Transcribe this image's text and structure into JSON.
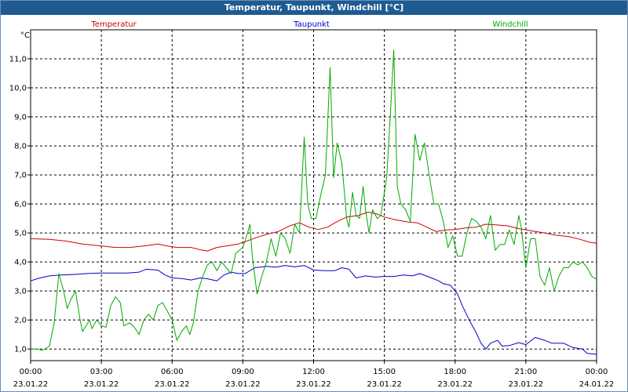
{
  "window": {
    "title": "Temperatur, Taupunkt, Windchill [°C]"
  },
  "chart_data": {
    "type": "line",
    "title": "Temperatur, Taupunkt, Windchill [°C]",
    "ylabel": "°C",
    "ylim": [
      0.6,
      12.0
    ],
    "xlim": [
      0,
      24
    ],
    "y_ticks": [
      "1,0",
      "2,0",
      "3,0",
      "4,0",
      "5,0",
      "6,0",
      "7,0",
      "8,0",
      "9,0",
      "10,0",
      "11,0"
    ],
    "y_tick_values": [
      1,
      2,
      3,
      4,
      5,
      6,
      7,
      8,
      9,
      10,
      11
    ],
    "x_ticks": [
      {
        "time": "00:00",
        "date": "23.01.22"
      },
      {
        "time": "03:00",
        "date": "23.01.22"
      },
      {
        "time": "06:00",
        "date": "23.01.22"
      },
      {
        "time": "09:00",
        "date": "23.01.22"
      },
      {
        "time": "12:00",
        "date": "23.01.22"
      },
      {
        "time": "15:00",
        "date": "23.01.22"
      },
      {
        "time": "18:00",
        "date": "23.01.22"
      },
      {
        "time": "21:00",
        "date": "23.01.22"
      },
      {
        "time": "00:00",
        "date": "24.01.22"
      }
    ],
    "grid": true,
    "legend_position": "top",
    "x_unit": "hours",
    "series": [
      {
        "name": "Temperatur",
        "color": "#cc0000",
        "points": [
          [
            0,
            4.8
          ],
          [
            0.8,
            4.78
          ],
          [
            1.5,
            4.72
          ],
          [
            2.2,
            4.62
          ],
          [
            3.0,
            4.55
          ],
          [
            3.6,
            4.5
          ],
          [
            4.2,
            4.5
          ],
          [
            4.8,
            4.55
          ],
          [
            5.4,
            4.62
          ],
          [
            5.8,
            4.55
          ],
          [
            6.2,
            4.5
          ],
          [
            6.8,
            4.5
          ],
          [
            7.2,
            4.42
          ],
          [
            7.5,
            4.38
          ],
          [
            7.9,
            4.5
          ],
          [
            8.3,
            4.55
          ],
          [
            8.8,
            4.62
          ],
          [
            9.1,
            4.7
          ],
          [
            9.6,
            4.85
          ],
          [
            10.0,
            4.95
          ],
          [
            10.5,
            5.05
          ],
          [
            11.0,
            5.25
          ],
          [
            11.4,
            5.35
          ],
          [
            11.8,
            5.2
          ],
          [
            12.2,
            5.12
          ],
          [
            12.6,
            5.2
          ],
          [
            12.9,
            5.35
          ],
          [
            13.4,
            5.55
          ],
          [
            13.9,
            5.6
          ],
          [
            14.3,
            5.72
          ],
          [
            14.7,
            5.65
          ],
          [
            15.0,
            5.55
          ],
          [
            15.5,
            5.45
          ],
          [
            16.0,
            5.38
          ],
          [
            16.4,
            5.35
          ],
          [
            16.8,
            5.2
          ],
          [
            17.2,
            5.05
          ],
          [
            17.6,
            5.1
          ],
          [
            18.0,
            5.12
          ],
          [
            18.5,
            5.18
          ],
          [
            18.9,
            5.2
          ],
          [
            19.3,
            5.3
          ],
          [
            19.7,
            5.28
          ],
          [
            20.2,
            5.25
          ],
          [
            20.7,
            5.15
          ],
          [
            21.2,
            5.08
          ],
          [
            21.8,
            5.0
          ],
          [
            22.3,
            4.92
          ],
          [
            22.8,
            4.88
          ],
          [
            23.3,
            4.78
          ],
          [
            23.7,
            4.68
          ],
          [
            24.0,
            4.65
          ]
        ]
      },
      {
        "name": "Taupunkt",
        "color": "#0000cc",
        "points": [
          [
            0,
            3.35
          ],
          [
            0.4,
            3.45
          ],
          [
            0.8,
            3.52
          ],
          [
            1.3,
            3.55
          ],
          [
            1.8,
            3.57
          ],
          [
            2.4,
            3.6
          ],
          [
            3.0,
            3.62
          ],
          [
            3.6,
            3.62
          ],
          [
            4.1,
            3.62
          ],
          [
            4.6,
            3.65
          ],
          [
            4.9,
            3.75
          ],
          [
            5.4,
            3.72
          ],
          [
            5.7,
            3.55
          ],
          [
            6.0,
            3.45
          ],
          [
            6.4,
            3.43
          ],
          [
            6.8,
            3.38
          ],
          [
            7.2,
            3.45
          ],
          [
            7.5,
            3.42
          ],
          [
            7.9,
            3.35
          ],
          [
            8.2,
            3.55
          ],
          [
            8.5,
            3.65
          ],
          [
            8.8,
            3.6
          ],
          [
            9.1,
            3.6
          ],
          [
            9.5,
            3.8
          ],
          [
            10.0,
            3.85
          ],
          [
            10.4,
            3.82
          ],
          [
            10.8,
            3.88
          ],
          [
            11.2,
            3.83
          ],
          [
            11.6,
            3.88
          ],
          [
            12.0,
            3.72
          ],
          [
            12.5,
            3.7
          ],
          [
            12.9,
            3.7
          ],
          [
            13.2,
            3.8
          ],
          [
            13.5,
            3.75
          ],
          [
            13.8,
            3.45
          ],
          [
            14.2,
            3.52
          ],
          [
            14.6,
            3.48
          ],
          [
            15.0,
            3.5
          ],
          [
            15.4,
            3.5
          ],
          [
            15.8,
            3.55
          ],
          [
            16.2,
            3.52
          ],
          [
            16.5,
            3.6
          ],
          [
            17.0,
            3.45
          ],
          [
            17.3,
            3.35
          ],
          [
            17.5,
            3.25
          ],
          [
            17.8,
            3.2
          ],
          [
            18.1,
            2.9
          ],
          [
            18.3,
            2.5
          ],
          [
            18.6,
            2.0
          ],
          [
            18.9,
            1.55
          ],
          [
            19.1,
            1.2
          ],
          [
            19.3,
            1.0
          ],
          [
            19.5,
            1.2
          ],
          [
            19.8,
            1.3
          ],
          [
            20.0,
            1.1
          ],
          [
            20.3,
            1.12
          ],
          [
            20.7,
            1.22
          ],
          [
            21.0,
            1.15
          ],
          [
            21.4,
            1.4
          ],
          [
            21.8,
            1.3
          ],
          [
            22.1,
            1.2
          ],
          [
            22.6,
            1.2
          ],
          [
            23.0,
            1.05
          ],
          [
            23.4,
            1.0
          ],
          [
            23.6,
            0.85
          ],
          [
            24.0,
            0.82
          ]
        ]
      },
      {
        "name": "Windchill",
        "color": "#00aa00",
        "points": [
          [
            0,
            1.0
          ],
          [
            0.3,
            1.0
          ],
          [
            0.5,
            0.95
          ],
          [
            0.8,
            1.1
          ],
          [
            1.0,
            1.9
          ],
          [
            1.2,
            3.6
          ],
          [
            1.4,
            3.0
          ],
          [
            1.55,
            2.4
          ],
          [
            1.7,
            2.7
          ],
          [
            1.9,
            3.0
          ],
          [
            2.1,
            2.0
          ],
          [
            2.2,
            1.6
          ],
          [
            2.5,
            2.0
          ],
          [
            2.6,
            1.7
          ],
          [
            2.8,
            2.0
          ],
          [
            3.0,
            1.8
          ],
          [
            3.2,
            1.75
          ],
          [
            3.4,
            2.5
          ],
          [
            3.6,
            2.8
          ],
          [
            3.8,
            2.6
          ],
          [
            3.95,
            1.8
          ],
          [
            4.2,
            1.9
          ],
          [
            4.4,
            1.75
          ],
          [
            4.6,
            1.5
          ],
          [
            4.8,
            2.0
          ],
          [
            5.0,
            2.2
          ],
          [
            5.2,
            2.0
          ],
          [
            5.4,
            2.5
          ],
          [
            5.6,
            2.6
          ],
          [
            5.8,
            2.3
          ],
          [
            6.0,
            2.0
          ],
          [
            6.2,
            1.3
          ],
          [
            6.4,
            1.6
          ],
          [
            6.6,
            1.8
          ],
          [
            6.75,
            1.5
          ],
          [
            6.9,
            1.9
          ],
          [
            7.1,
            3.0
          ],
          [
            7.3,
            3.5
          ],
          [
            7.5,
            3.9
          ],
          [
            7.7,
            4.0
          ],
          [
            7.9,
            3.7
          ],
          [
            8.1,
            4.0
          ],
          [
            8.3,
            3.8
          ],
          [
            8.5,
            3.6
          ],
          [
            8.7,
            4.3
          ],
          [
            9.0,
            4.5
          ],
          [
            9.2,
            5.0
          ],
          [
            9.3,
            5.3
          ],
          [
            9.4,
            4.2
          ],
          [
            9.6,
            2.9
          ],
          [
            9.8,
            3.5
          ],
          [
            10.0,
            4.0
          ],
          [
            10.2,
            4.8
          ],
          [
            10.4,
            4.2
          ],
          [
            10.6,
            5.0
          ],
          [
            10.8,
            4.8
          ],
          [
            11.0,
            4.3
          ],
          [
            11.2,
            5.3
          ],
          [
            11.4,
            5.0
          ],
          [
            11.6,
            8.3
          ],
          [
            11.75,
            6.0
          ],
          [
            11.9,
            5.5
          ],
          [
            12.1,
            5.5
          ],
          [
            12.3,
            6.3
          ],
          [
            12.5,
            7.0
          ],
          [
            12.7,
            10.7
          ],
          [
            12.85,
            6.9
          ],
          [
            13.0,
            8.1
          ],
          [
            13.2,
            7.4
          ],
          [
            13.4,
            5.5
          ],
          [
            13.5,
            5.2
          ],
          [
            13.65,
            6.4
          ],
          [
            13.8,
            5.6
          ],
          [
            13.95,
            5.5
          ],
          [
            14.1,
            6.6
          ],
          [
            14.2,
            5.8
          ],
          [
            14.35,
            5.0
          ],
          [
            14.5,
            5.8
          ],
          [
            14.7,
            5.5
          ],
          [
            14.85,
            5.6
          ],
          [
            15.1,
            6.9
          ],
          [
            15.25,
            9.0
          ],
          [
            15.4,
            11.3
          ],
          [
            15.55,
            6.6
          ],
          [
            15.7,
            6.0
          ],
          [
            15.9,
            5.8
          ],
          [
            16.1,
            5.4
          ],
          [
            16.3,
            8.4
          ],
          [
            16.5,
            7.5
          ],
          [
            16.7,
            8.1
          ],
          [
            16.9,
            7.0
          ],
          [
            17.1,
            6.0
          ],
          [
            17.3,
            6.0
          ],
          [
            17.5,
            5.4
          ],
          [
            17.7,
            4.5
          ],
          [
            17.9,
            4.9
          ],
          [
            18.1,
            4.2
          ],
          [
            18.3,
            4.2
          ],
          [
            18.5,
            5.0
          ],
          [
            18.7,
            5.5
          ],
          [
            18.9,
            5.4
          ],
          [
            19.1,
            5.2
          ],
          [
            19.3,
            4.8
          ],
          [
            19.5,
            5.6
          ],
          [
            19.7,
            4.4
          ],
          [
            19.9,
            4.6
          ],
          [
            20.1,
            4.6
          ],
          [
            20.3,
            5.1
          ],
          [
            20.5,
            4.6
          ],
          [
            20.7,
            5.6
          ],
          [
            20.8,
            5.2
          ],
          [
            21.0,
            3.8
          ],
          [
            21.2,
            4.8
          ],
          [
            21.4,
            4.8
          ],
          [
            21.6,
            3.5
          ],
          [
            21.8,
            3.2
          ],
          [
            22.0,
            3.8
          ],
          [
            22.2,
            3.0
          ],
          [
            22.4,
            3.5
          ],
          [
            22.6,
            3.8
          ],
          [
            22.8,
            3.8
          ],
          [
            23.0,
            4.0
          ],
          [
            23.2,
            3.9
          ],
          [
            23.4,
            4.0
          ],
          [
            23.6,
            3.8
          ],
          [
            23.8,
            3.5
          ],
          [
            24.0,
            3.4
          ]
        ]
      }
    ]
  }
}
